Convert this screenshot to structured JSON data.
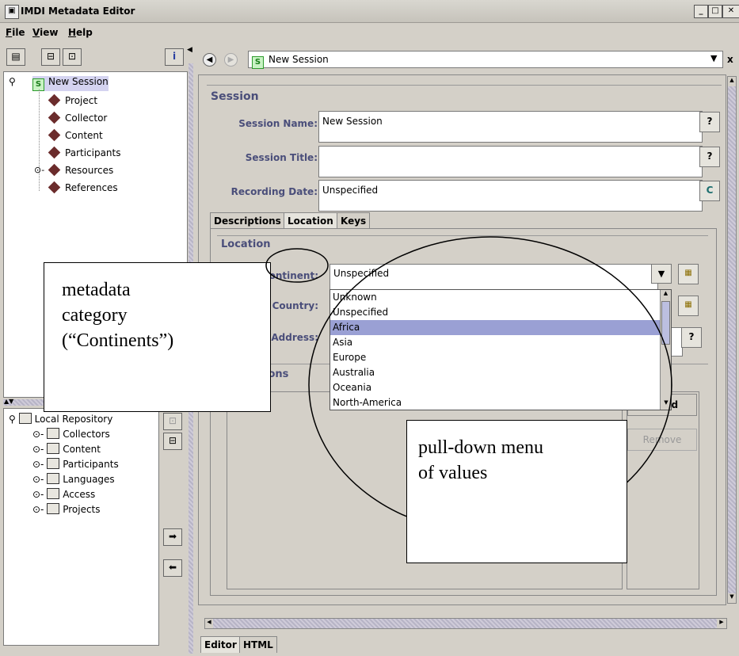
{
  "window": {
    "title": "IMDI Metadata Editor"
  },
  "menubar": [
    "File",
    "View",
    "Help"
  ],
  "tree": {
    "root": "New Session",
    "children": [
      "Project",
      "Collector",
      "Content",
      "Participants",
      "Resources",
      "References"
    ]
  },
  "repository": {
    "root": "Local Repository",
    "children": [
      "Collectors",
      "Content",
      "Participants",
      "Languages",
      "Access",
      "Projects"
    ]
  },
  "nav": {
    "current_session": "New Session",
    "session_badge": "S"
  },
  "session": {
    "heading": "Session",
    "name_label": "Session Name:",
    "name_value": "New Session",
    "title_label": "Session Title:",
    "title_value": "",
    "date_label": "Recording Date:",
    "date_value": "Unspecified"
  },
  "tabs": [
    "Descriptions",
    "Location",
    "Keys"
  ],
  "location": {
    "heading": "Location",
    "continent_label": "Continent:",
    "continent_value": "Unspecified",
    "country_label": "Country:",
    "address_label": "Address:",
    "descriptions_partial": "ions"
  },
  "dropdown": {
    "options": [
      "Unknown",
      "Unspecified",
      "Africa",
      "Asia",
      "Europe",
      "Australia",
      "Oceania",
      "North-America"
    ],
    "highlighted": "Africa"
  },
  "buttons": {
    "add_partial": "...Add",
    "remove": "Remove"
  },
  "bottom_tabs": [
    "Editor",
    "HTML"
  ],
  "annotations": {
    "category_line1": "metadata",
    "category_line2": "category",
    "category_line3": "(“Continents”)",
    "menu_line1": "pull-down menu",
    "menu_line2": "of values"
  },
  "colors": {
    "accent": "#4a4e7a",
    "selection": "#a7a6d3",
    "highlight": "#9aa0d4"
  }
}
